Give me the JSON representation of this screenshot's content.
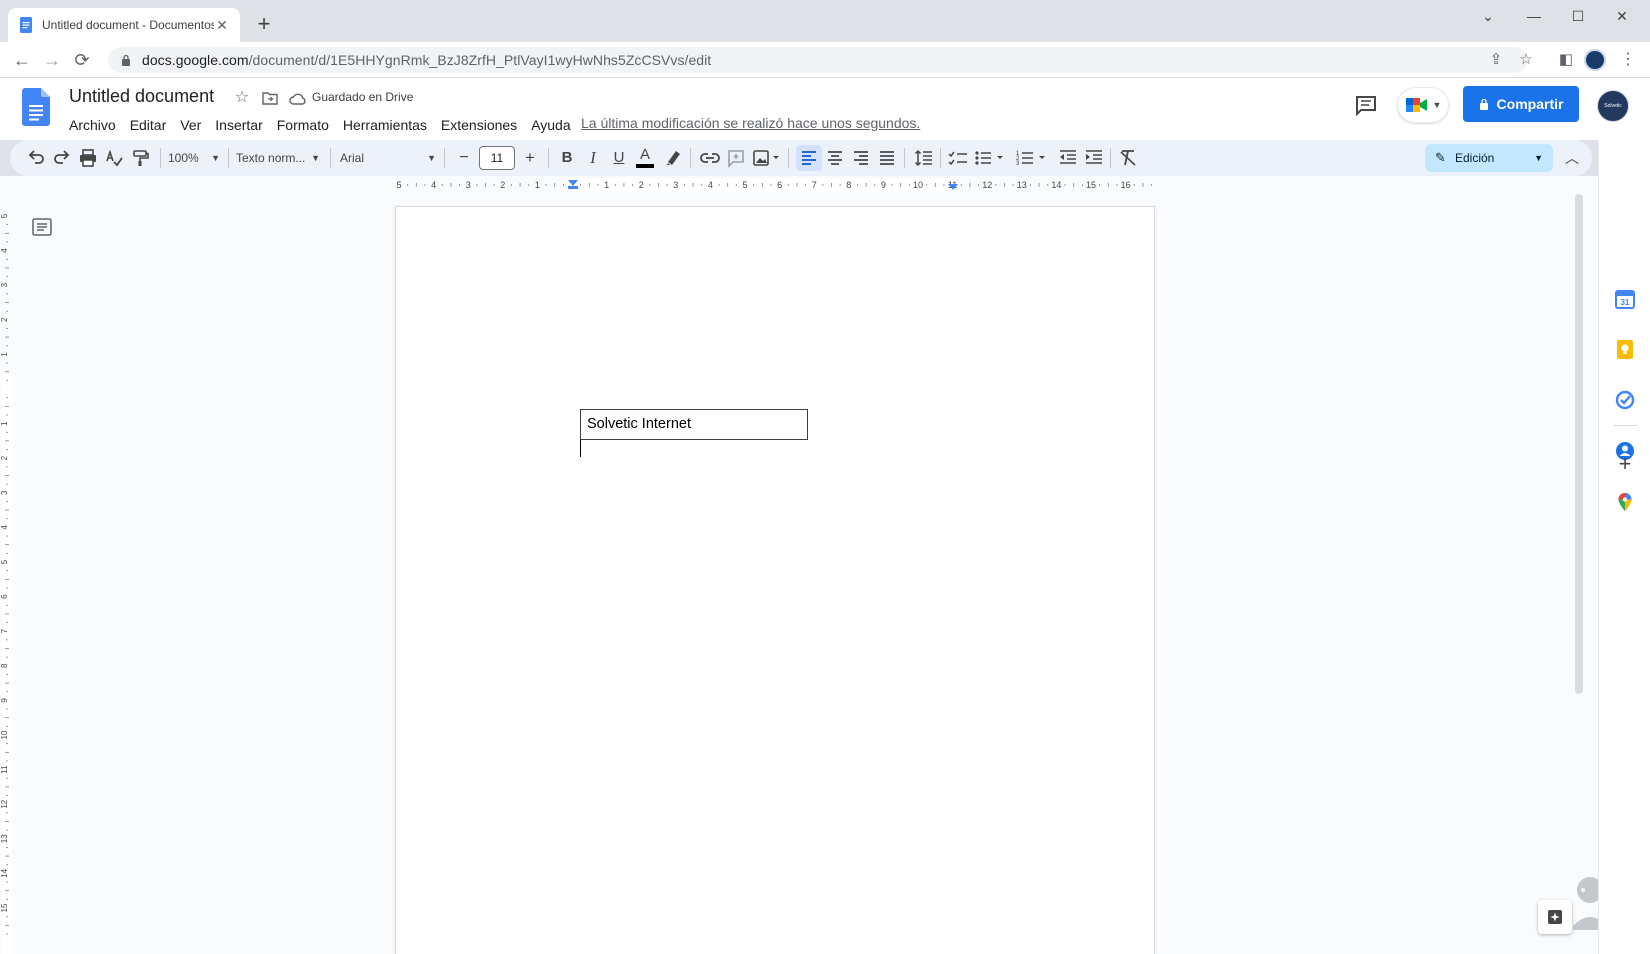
{
  "browser": {
    "tab": {
      "title": "Untitled document - Documentos de Google",
      "close": "✕"
    },
    "new_tab": "+",
    "window_controls": {
      "dropdown": "⌄",
      "minimize": "—",
      "maximize": "☐",
      "close": "✕"
    },
    "url": {
      "domain": "docs.google.com",
      "path": "/document/d/1E5HHYgnRmk_BzJ8ZrfH_PtlVayI1wyHwNhs5ZcCSVvs/edit"
    },
    "nav": {
      "back": "←",
      "forward": "→",
      "reload": "⟳"
    }
  },
  "docs": {
    "title": "Untitled document",
    "saved_status": "Guardado en Drive",
    "menu": [
      "Archivo",
      "Editar",
      "Ver",
      "Insertar",
      "Formato",
      "Herramientas",
      "Extensiones",
      "Ayuda"
    ],
    "last_modified": "La última modificación se realizó hace unos segundos.",
    "share_label": "Compartir",
    "avatar_text": "Solvetic"
  },
  "toolbar": {
    "zoom": "100%",
    "style": "Texto norm...",
    "font": "Arial",
    "font_size": "11",
    "decrease": "−",
    "increase": "+",
    "bold": "B",
    "italic": "I",
    "underline": "U",
    "text_color": "A",
    "mode": "Edición"
  },
  "ruler": {
    "horizontal": [
      "5",
      "4",
      "3",
      "2",
      "1",
      "",
      "1",
      "2",
      "3",
      "4",
      "5",
      "6",
      "7",
      "8",
      "9",
      "10",
      "11",
      "12",
      "13",
      "14",
      "15",
      "16"
    ],
    "vertical": [
      "5",
      "4",
      "3",
      "2",
      "1",
      "",
      "1",
      "2",
      "3",
      "4",
      "5",
      "6",
      "7",
      "8",
      "9",
      "10",
      "11",
      "12",
      "13",
      "14",
      "15"
    ]
  },
  "document": {
    "textbox_text": "Solvetic Internet"
  },
  "colors": {
    "accent": "#1a73e8",
    "toolbar_bg": "#edf2fa",
    "mode_bg": "#c2e7ff",
    "docs_blue": "#4285f4"
  }
}
